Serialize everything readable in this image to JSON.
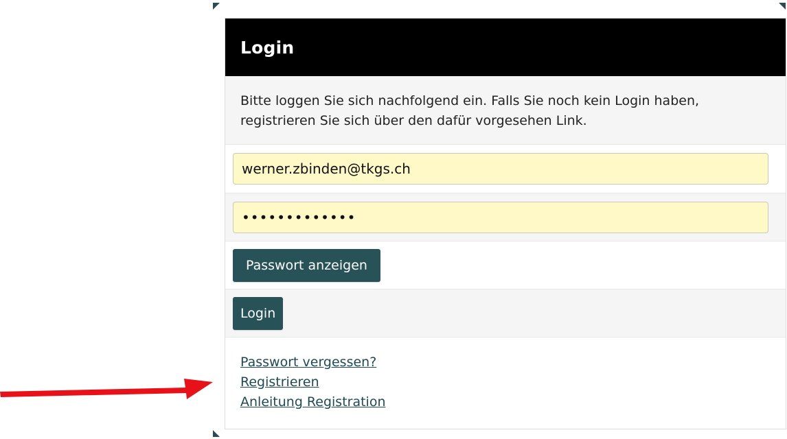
{
  "login": {
    "title": "Login",
    "intro": "Bitte loggen Sie sich nachfolgend ein. Falls Sie noch kein Login haben, registrieren Sie sich über den dafür vorgesehen Link.",
    "email_value": "werner.zbinden@tkgs.ch",
    "password_mask": "•••••••••••••",
    "show_password_label": "Passwort anzeigen",
    "login_button_label": "Login"
  },
  "links": [
    {
      "label": "Passwort vergessen?"
    },
    {
      "label": "Registrieren"
    },
    {
      "label": "Anleitung Registration"
    }
  ],
  "colors": {
    "header_bg": "#000000",
    "button_bg": "#275358",
    "input_autofill_bg": "#fff9c8",
    "annotation_arrow": "#e8111a"
  },
  "annotation": {
    "arrow_icon": "arrow-right-icon"
  }
}
